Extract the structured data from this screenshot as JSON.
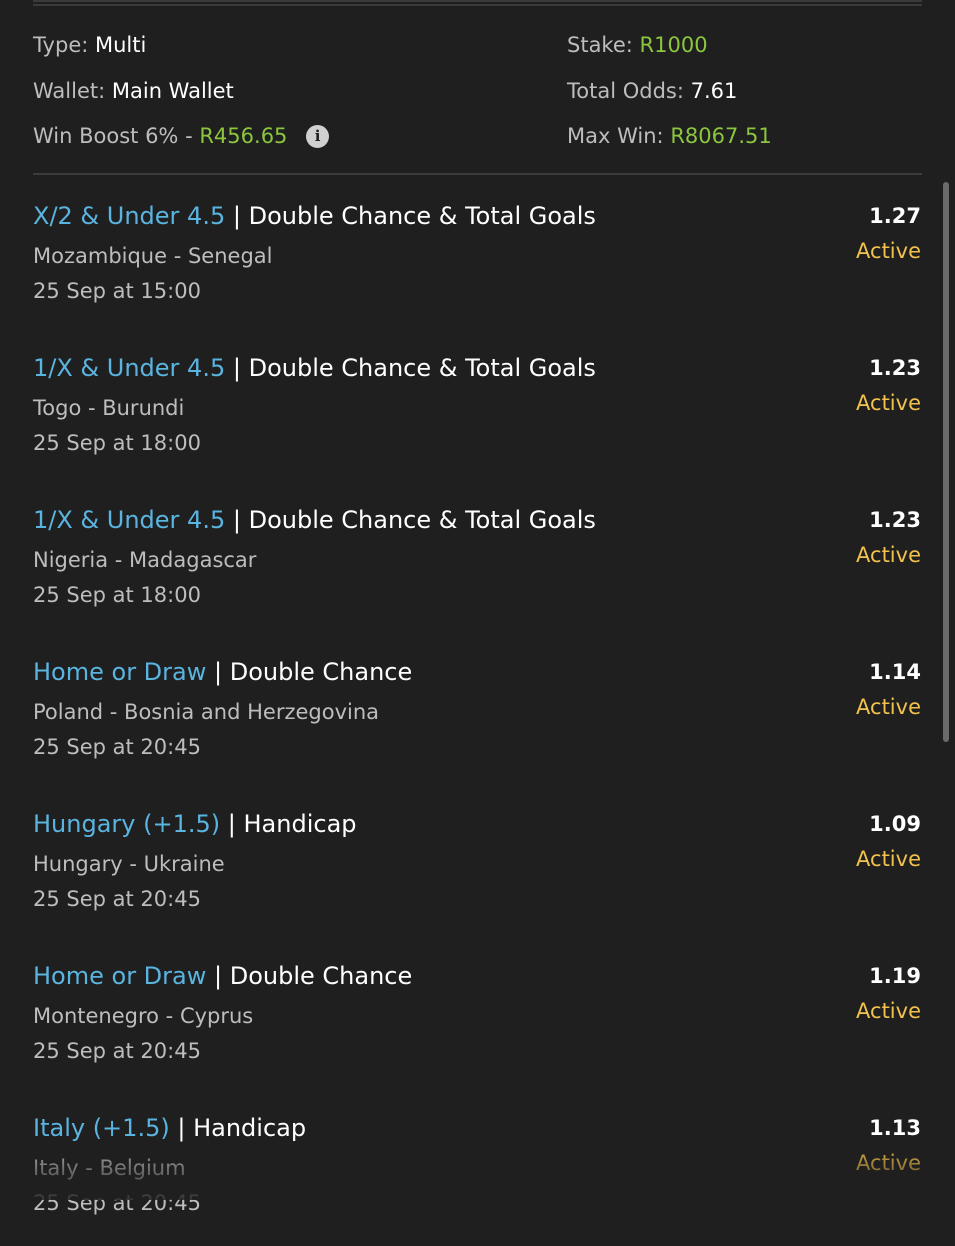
{
  "summary": {
    "type_label": "Type:",
    "type_value": "Multi",
    "wallet_label": "Wallet:",
    "wallet_value": "Main Wallet",
    "win_boost_label": "Win Boost 6% -",
    "win_boost_value": "R456.65",
    "stake_label": "Stake:",
    "stake_value": "R1000",
    "total_odds_label": "Total Odds:",
    "total_odds_value": "7.61",
    "max_win_label": "Max Win:",
    "max_win_value": "R8067.51",
    "info_icon": "info-icon"
  },
  "legs": [
    {
      "selection": "X/2 & Under 4.5",
      "separator": "|",
      "market": "Double Chance & Total Goals",
      "match": "Mozambique - Senegal",
      "time": "25 Sep at 15:00",
      "odds": "1.27",
      "status": "Active"
    },
    {
      "selection": "1/X & Under 4.5",
      "separator": "|",
      "market": "Double Chance & Total Goals",
      "match": "Togo - Burundi",
      "time": "25 Sep at 18:00",
      "odds": "1.23",
      "status": "Active"
    },
    {
      "selection": "1/X & Under 4.5",
      "separator": "|",
      "market": "Double Chance & Total Goals",
      "match": "Nigeria - Madagascar",
      "time": "25 Sep at 18:00",
      "odds": "1.23",
      "status": "Active"
    },
    {
      "selection": "Home or Draw",
      "separator": "|",
      "market": "Double Chance",
      "match": "Poland - Bosnia and Herzegovina",
      "time": "25 Sep at 20:45",
      "odds": "1.14",
      "status": "Active"
    },
    {
      "selection": "Hungary (+1.5)",
      "separator": "|",
      "market": "Handicap",
      "match": "Hungary - Ukraine",
      "time": "25 Sep at 20:45",
      "odds": "1.09",
      "status": "Active"
    },
    {
      "selection": "Home or Draw",
      "separator": "|",
      "market": "Double Chance",
      "match": "Montenegro - Cyprus",
      "time": "25 Sep at 20:45",
      "odds": "1.19",
      "status": "Active"
    },
    {
      "selection": "Italy (+1.5)",
      "separator": "|",
      "market": "Handicap",
      "match": "Italy - Belgium",
      "time": "25 Sep at 20:45",
      "odds": "1.13",
      "status": "Active"
    }
  ],
  "colors": {
    "background": "#1f1f1f",
    "selection_blue": "#5ab4e0",
    "status_active": "#f2c14e",
    "money_green": "#8cc63f",
    "muted_text": "#bdbdbd"
  }
}
